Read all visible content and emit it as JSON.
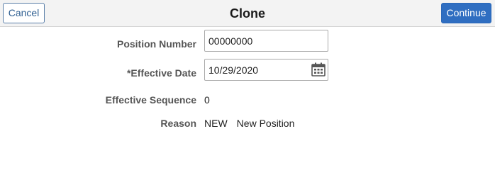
{
  "header": {
    "title": "Clone",
    "cancel_label": "Cancel",
    "continue_label": "Continue"
  },
  "form": {
    "position_number": {
      "label": "Position Number",
      "value": "00000000"
    },
    "effective_date": {
      "label": "*Effective Date",
      "value": "10/29/2020",
      "icon": "calendar-icon"
    },
    "effective_sequence": {
      "label": "Effective Sequence",
      "value": "0"
    },
    "reason": {
      "label": "Reason",
      "code": "NEW",
      "description": "New Position"
    }
  },
  "colors": {
    "header_bg": "#f3f3f3",
    "primary_button": "#2f6ec1",
    "secondary_button_text": "#2f5f91",
    "label_text": "#555555"
  }
}
